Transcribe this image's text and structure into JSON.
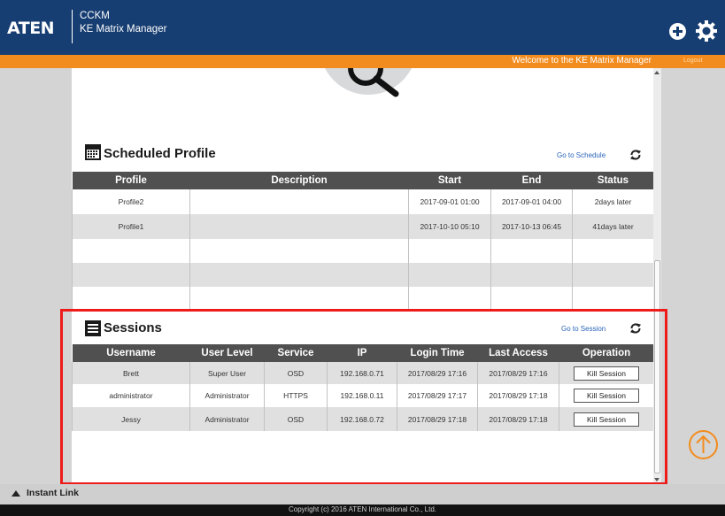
{
  "header": {
    "logo": "ATEN",
    "app_line1": "CCKM",
    "app_line2": "KE Matrix Manager",
    "welcome": "Welcome to the KE Matrix Manager",
    "logout": "Logout"
  },
  "scheduled_profile": {
    "title": "Scheduled Profile",
    "goto": "Go to Schedule",
    "columns": [
      "Profile",
      "Description",
      "Start",
      "End",
      "Status"
    ],
    "rows": [
      [
        "Profile2",
        "",
        "2017-09-01 01:00",
        "2017-09-01 04:00",
        "2days later"
      ],
      [
        "Profile1",
        "",
        "2017-10-10 05:10",
        "2017-10-13 06:45",
        "41days later"
      ]
    ]
  },
  "sessions": {
    "title": "Sessions",
    "goto": "Go to Session",
    "columns": [
      "Username",
      "User Level",
      "Service",
      "IP",
      "Login Time",
      "Last Access",
      "Operation"
    ],
    "rows": [
      [
        "Brett",
        "Super User",
        "OSD",
        "192.168.0.71",
        "2017/08/29 17:16",
        "2017/08/29 17:16"
      ],
      [
        "administrator",
        "Administrator",
        "HTTPS",
        "192.168.0.11",
        "2017/08/29 17:17",
        "2017/08/29 17:18"
      ],
      [
        "Jessy",
        "Administrator",
        "OSD",
        "192.168.0.72",
        "2017/08/29 17:18",
        "2017/08/29 17:18"
      ]
    ],
    "kill_label": "Kill Session"
  },
  "instant_link": "Instant Link",
  "footer": "Copyright (c) 2016 ATEN International Co., Ltd.",
  "colors": {
    "header_bg": "#173e72",
    "accent_orange": "#f28c1e",
    "table_header": "#505050",
    "highlight": "#ee1b1b"
  },
  "icons": [
    "plus-circle-icon",
    "gear-icon",
    "calendar-icon",
    "list-icon",
    "refresh-icon",
    "magnifier-icon",
    "up-arrow-circle-icon"
  ]
}
